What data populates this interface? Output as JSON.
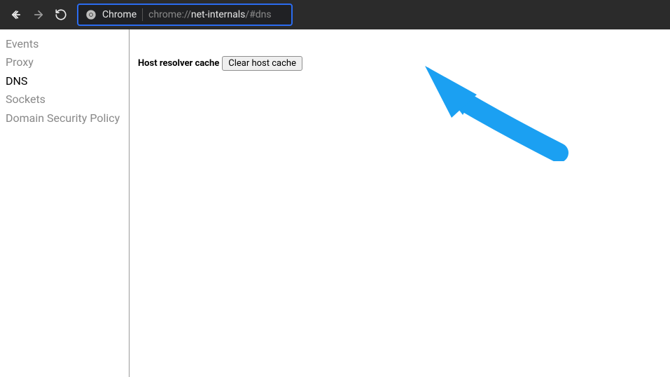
{
  "toolbar": {
    "chrome_label": "Chrome",
    "url_scheme": "chrome://",
    "url_host": "net-internals",
    "url_path": "/#dns"
  },
  "sidebar": {
    "items": [
      {
        "label": "Events",
        "active": false
      },
      {
        "label": "Proxy",
        "active": false
      },
      {
        "label": "DNS",
        "active": true
      },
      {
        "label": "Sockets",
        "active": false
      },
      {
        "label": "Domain Security Policy",
        "active": false
      }
    ]
  },
  "main": {
    "cache_label": "Host resolver cache",
    "clear_button_label": "Clear host cache"
  },
  "annotation": {
    "arrow_color": "#1ba0f2"
  }
}
